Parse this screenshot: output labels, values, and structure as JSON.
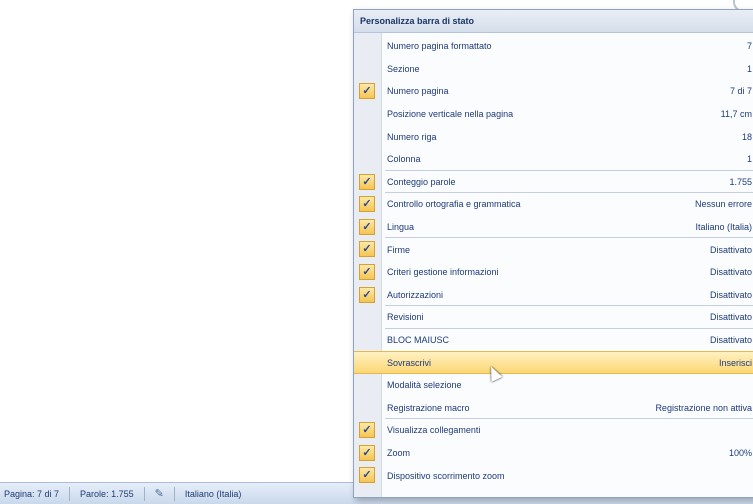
{
  "status_bar": {
    "page": "Pagina: 7 di 7",
    "words": "Parole: 1.755",
    "language": "Italiano (Italia)"
  },
  "menu": {
    "title": "Personalizza barra di stato",
    "items": [
      {
        "label": "Numero pagina formattato",
        "value": "7",
        "checked": false
      },
      {
        "label": "Sezione",
        "value": "1",
        "checked": false
      },
      {
        "label": "Numero pagina",
        "value": "7 di 7",
        "checked": true
      },
      {
        "label": "Posizione verticale nella pagina",
        "value": "11,7 cm",
        "checked": false
      },
      {
        "label": "Numero riga",
        "value": "18",
        "checked": false
      },
      {
        "label": "Colonna",
        "value": "1",
        "checked": false
      },
      {
        "label": "Conteggio parole",
        "value": "1.755",
        "checked": true
      },
      {
        "label": "Controllo ortografia e grammatica",
        "value": "Nessun errore",
        "checked": true
      },
      {
        "label": "Lingua",
        "value": "Italiano (Italia)",
        "checked": true
      },
      {
        "label": "Firme",
        "value": "Disattivato",
        "checked": true
      },
      {
        "label": "Criteri gestione informazioni",
        "value": "Disattivato",
        "checked": true
      },
      {
        "label": "Autorizzazioni",
        "value": "Disattivato",
        "checked": true
      },
      {
        "label": "Revisioni",
        "value": "Disattivato",
        "checked": false
      },
      {
        "label": "BLOC MAIUSC",
        "value": "Disattivato",
        "checked": false
      },
      {
        "label": "Sovrascrivi",
        "value": "Inserisci",
        "checked": false
      },
      {
        "label": "Modalità selezione",
        "value": "",
        "checked": false
      },
      {
        "label": "Registrazione macro",
        "value": "Registrazione non attiva",
        "checked": false
      },
      {
        "label": "Visualizza collegamenti",
        "value": "",
        "checked": true
      },
      {
        "label": "Zoom",
        "value": "100%",
        "checked": true
      },
      {
        "label": "Dispositivo scorrimento zoom",
        "value": "",
        "checked": true
      }
    ]
  }
}
